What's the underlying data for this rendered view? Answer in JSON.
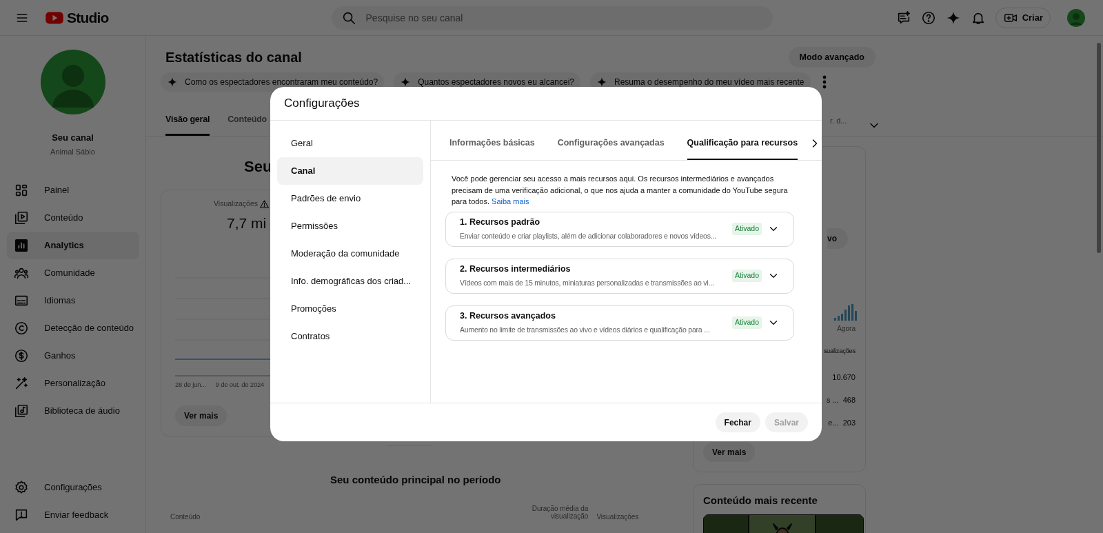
{
  "header": {
    "logo_text": "Studio",
    "search": {
      "placeholder": "Pesquise no seu canal"
    },
    "create_button": "Criar"
  },
  "sidebar": {
    "channel_name": "Seu canal",
    "channel_handle": "Animal Sábio",
    "items": [
      {
        "label": "Painel",
        "selected": false
      },
      {
        "label": "Conteúdo",
        "selected": false
      },
      {
        "label": "Analytics",
        "selected": true
      },
      {
        "label": "Comunidade",
        "selected": false
      },
      {
        "label": "Idiomas",
        "selected": false
      },
      {
        "label": "Detecção de conteúdo",
        "selected": false
      },
      {
        "label": "Ganhos",
        "selected": false
      },
      {
        "label": "Personalização",
        "selected": false
      },
      {
        "label": "Biblioteca de áudio",
        "selected": false
      }
    ],
    "footer_items": [
      "Configurações",
      "Enviar feedback"
    ]
  },
  "page": {
    "title": "Estatísticas do canal",
    "advanced_button": "Modo avançado",
    "chips": [
      "Como os espectadores encontraram meu conteúdo?",
      "Quantos espectadores novos eu alcancei?",
      "Resuma o desempenho do meu vídeo mais recente"
    ],
    "tabs": [
      {
        "label": "Visão geral",
        "selected": true
      },
      {
        "label": "Conteúdo",
        "selected": false
      }
    ],
    "period_dropdown": "r. d...",
    "overview_heading": "Seu",
    "metric": {
      "label": "Visualizações",
      "value": "7,7 mi"
    },
    "chart_x_labels": [
      "28 de jun...",
      "9 de out. de 2024"
    ],
    "see_more": "Ver mais",
    "top_content": {
      "title": "Seu conteúdo principal no período",
      "columns": [
        "Conteúdo",
        "Duração média da visualização",
        "Visualizações"
      ]
    }
  },
  "realtime_card": {
    "partial_button": "vo",
    "time_label": "Agora",
    "column_header": "sualizações",
    "rows": [
      {
        "label": "",
        "value": "10.670"
      },
      {
        "label": "s ...",
        "value": "468"
      },
      {
        "label": "e...",
        "value": "203"
      }
    ],
    "see_more": "Ver mais"
  },
  "latest_card": {
    "title": "Conteúdo mais recente"
  },
  "dialog": {
    "title": "Configurações",
    "nav": [
      {
        "label": "Geral",
        "selected": false
      },
      {
        "label": "Canal",
        "selected": true
      },
      {
        "label": "Padrões de envio",
        "selected": false
      },
      {
        "label": "Permissões",
        "selected": false
      },
      {
        "label": "Moderação da comunidade",
        "selected": false
      },
      {
        "label": "Info. demográficas dos criad...",
        "selected": false
      },
      {
        "label": "Promoções",
        "selected": false
      },
      {
        "label": "Contratos",
        "selected": false
      }
    ],
    "tabs": [
      {
        "label": "Informações básicas",
        "selected": false
      },
      {
        "label": "Configurações avançadas",
        "selected": false
      },
      {
        "label": "Qualificação para recursos",
        "selected": true
      }
    ],
    "description": "Você pode gerenciar seu acesso a mais recursos aqui. Os recursos intermediários e avançados precisam de uma verificação adicional, o que nos ajuda a manter a comunidade do YouTube segura para todos.",
    "learn_more": "Saiba mais",
    "features": [
      {
        "title": "1. Recursos padrão",
        "subtitle": "Enviar conteúdo e criar playlists, além de adicionar colaboradores e novos vídeos...",
        "status": "Ativado",
        "enabled": true
      },
      {
        "title": "2. Recursos intermediários",
        "subtitle": "Vídeos com mais de 15 minutos, miniaturas personalizadas e transmissões ao vi...",
        "status": "Ativado",
        "enabled": true
      },
      {
        "title": "3. Recursos avançados",
        "subtitle": "Aumento no limite de transmissões ao vivo e vídeos diários e qualificação para ...",
        "status": "Ativado",
        "enabled": true
      }
    ],
    "buttons": [
      {
        "label": "Fechar",
        "disabled": false
      },
      {
        "label": "Salvar",
        "disabled": true
      }
    ]
  }
}
